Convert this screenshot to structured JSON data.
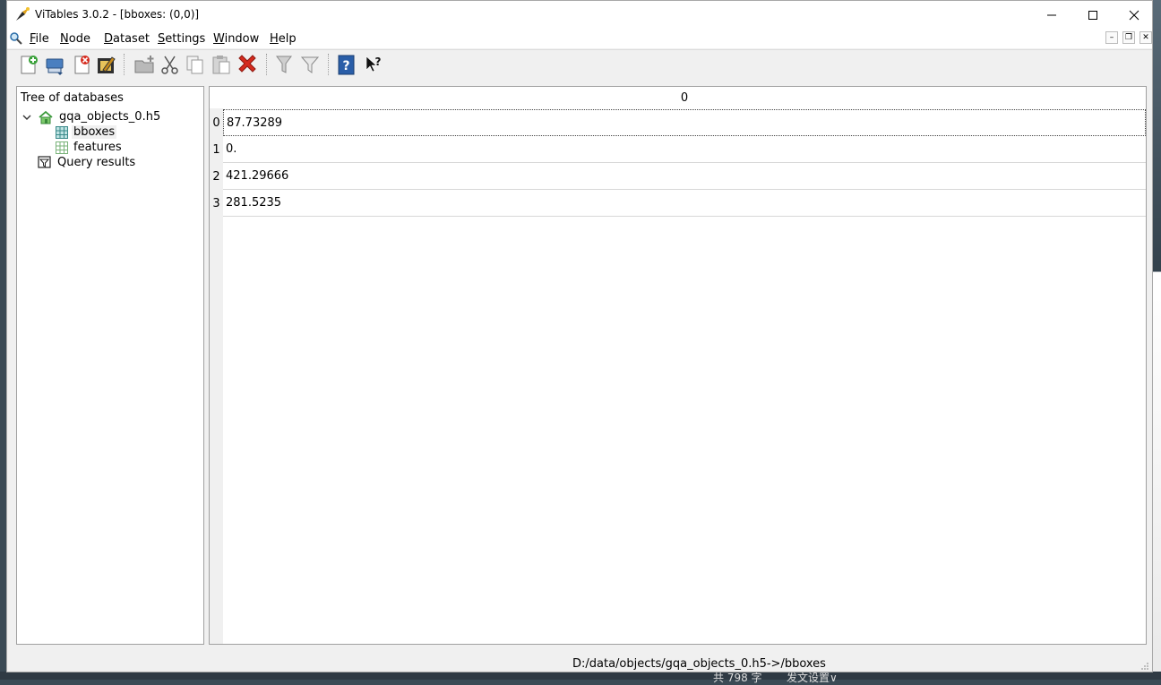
{
  "window": {
    "title": "ViTables 3.0.2 - [bboxes: (0,0)]",
    "minimize_glyph": "—",
    "maximize_glyph": "☐",
    "close_glyph": "✕"
  },
  "menu": {
    "items": [
      {
        "label": "File",
        "accel": "F",
        "rest": "ile"
      },
      {
        "label": "Node",
        "accel": "N",
        "rest": "ode"
      },
      {
        "label": "Dataset",
        "accel": "D",
        "rest": "ataset"
      },
      {
        "label": "Settings",
        "accel": "S",
        "rest": "ettings"
      },
      {
        "label": "Window",
        "accel": "W",
        "rest": "indow"
      },
      {
        "label": "Help",
        "accel": "H",
        "rest": "elp"
      }
    ],
    "mdi_minimize": "–",
    "mdi_restore": "❐",
    "mdi_close": "✕"
  },
  "toolbar": {
    "icons": [
      "new-file-icon",
      "open-file-icon",
      "close-file-icon",
      "save-as-icon",
      "new-group-icon",
      "cut-icon",
      "copy-icon",
      "paste-icon",
      "delete-icon",
      "query-icon",
      "filter-icon",
      "help-icon",
      "whats-this-icon"
    ]
  },
  "tree": {
    "header": "Tree of databases",
    "file_node": "gqa_objects_0.h5",
    "children": [
      "bboxes",
      "features"
    ],
    "query_node": "Query results",
    "selected": "bboxes"
  },
  "table": {
    "column_header": "0",
    "rows": [
      {
        "index": "0",
        "value": "87.73289"
      },
      {
        "index": "1",
        "value": "0."
      },
      {
        "index": "2",
        "value": "421.29666"
      },
      {
        "index": "3",
        "value": "281.5235"
      }
    ]
  },
  "status": {
    "path": "D:/data/objects/gqa_objects_0.h5->/bboxes"
  },
  "background": {
    "text_a": "共 798 字",
    "text_b": "发文设置∨"
  },
  "colors": {
    "table_grid_icon": "#3a8a8a",
    "delete_red": "#d52b1e",
    "help_blue": "#2a5ea8"
  }
}
